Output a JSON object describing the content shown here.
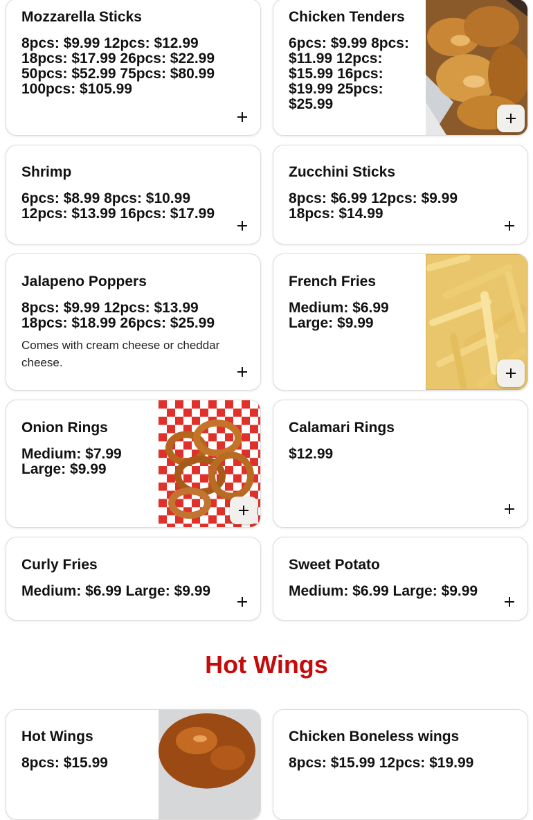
{
  "colors": {
    "section_title": "#c40c0c",
    "button_bg": "#f2f0ed"
  },
  "items": [
    {
      "name": "Mozzarella Sticks",
      "price": "8pcs: $9.99 12pcs: $12.99 18pcs: $17.99 26pcs: $22.99 50pcs: $52.99 75pcs: $80.99 100pcs: $105.99",
      "add_icon": "plus-icon"
    },
    {
      "name": "Chicken Tenders",
      "price": "6pcs: $9.99 8pcs: $11.99 12pcs: $15.99 16pcs: $19.99 25pcs: $25.99",
      "image": "chicken-tenders-photo",
      "add_icon": "plus-icon"
    },
    {
      "name": "Shrimp",
      "price": "6pcs: $8.99 8pcs: $10.99 12pcs: $13.99 16pcs: $17.99",
      "add_icon": "plus-icon"
    },
    {
      "name": "Zucchini Sticks",
      "price": "8pcs: $6.99 12pcs: $9.99 18pcs: $14.99",
      "add_icon": "plus-icon"
    },
    {
      "name": "Jalapeno Poppers",
      "price": "8pcs: $9.99 12pcs: $13.99 18pcs: $18.99 26pcs: $25.99",
      "description": "Comes with cream cheese or cheddar cheese.",
      "add_icon": "plus-icon"
    },
    {
      "name": "French Fries",
      "price": "Medium: $6.99 Large: $9.99",
      "image": "french-fries-photo",
      "add_icon": "plus-icon"
    },
    {
      "name": "Onion Rings",
      "price": "Medium: $7.99 Large: $9.99",
      "image": "onion-rings-photo",
      "add_icon": "plus-icon"
    },
    {
      "name": "Calamari Rings",
      "price": "$12.99",
      "add_icon": "plus-icon"
    },
    {
      "name": "Curly Fries",
      "price": "Medium: $6.99 Large: $9.99",
      "add_icon": "plus-icon"
    },
    {
      "name": "Sweet Potato",
      "price": "Medium: $6.99 Large: $9.99",
      "add_icon": "plus-icon"
    }
  ],
  "section": {
    "title": "Hot Wings"
  },
  "hot_wings": [
    {
      "name": "Hot Wings",
      "price": "8pcs: $15.99",
      "image": "hot-wings-photo"
    },
    {
      "name": "Chicken Boneless wings",
      "price": "8pcs: $15.99 12pcs: $19.99"
    }
  ]
}
